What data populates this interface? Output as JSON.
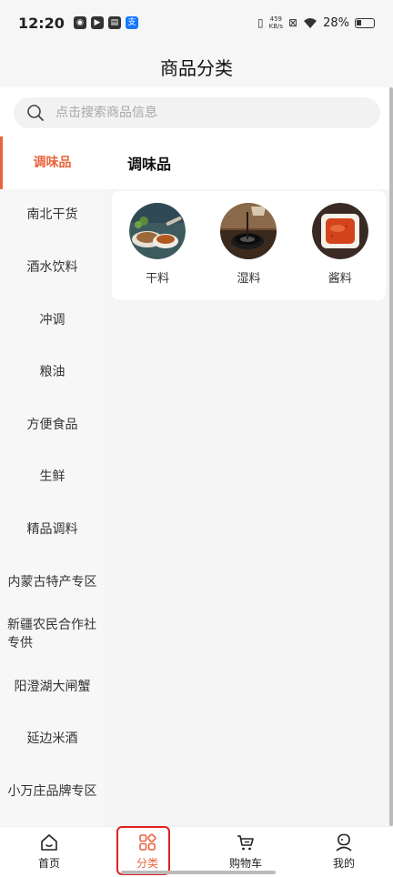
{
  "status_bar": {
    "time": "12:20",
    "net_speed_value": "459",
    "net_speed_unit": "KB/s",
    "battery": "28%"
  },
  "header": {
    "title": "商品分类"
  },
  "search": {
    "placeholder": "点击搜索商品信息"
  },
  "sidebar": {
    "items": [
      {
        "label": "调味品",
        "active": true
      },
      {
        "label": "南北干货"
      },
      {
        "label": "酒水饮料"
      },
      {
        "label": "冲调"
      },
      {
        "label": "粮油"
      },
      {
        "label": "方便食品"
      },
      {
        "label": "生鲜"
      },
      {
        "label": "精品调料"
      },
      {
        "label": "内蒙古特产专区"
      },
      {
        "label": "新疆农民合作社专供"
      },
      {
        "label": "阳澄湖大闸蟹"
      },
      {
        "label": "延边米酒"
      },
      {
        "label": "小万庄品牌专区"
      }
    ]
  },
  "main": {
    "section_title": "调味品",
    "categories": [
      {
        "label": "干料",
        "icon": "dry-seasoning-photo"
      },
      {
        "label": "湿料",
        "icon": "soy-sauce-photo"
      },
      {
        "label": "酱料",
        "icon": "sauce-photo"
      }
    ]
  },
  "tabbar": {
    "tabs": [
      {
        "label": "首页",
        "icon": "home-icon"
      },
      {
        "label": "分类",
        "icon": "category-icon",
        "active": true,
        "color": "#e8643c"
      },
      {
        "label": "购物车",
        "icon": "cart-icon"
      },
      {
        "label": "我的",
        "icon": "profile-icon"
      }
    ]
  },
  "colors": {
    "accent": "#e8643c",
    "highlight": "#e02020"
  }
}
